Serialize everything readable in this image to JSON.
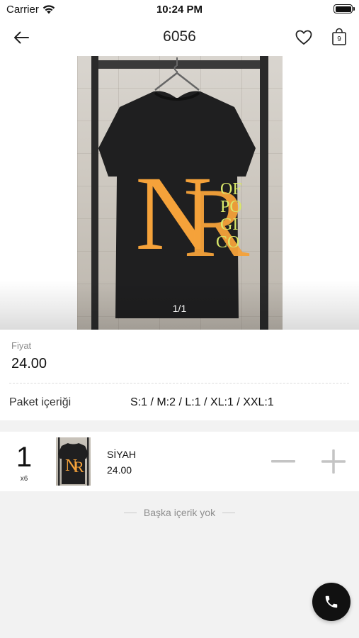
{
  "status_bar": {
    "carrier": "Carrier",
    "time": "10:24 PM"
  },
  "nav": {
    "title": "6056",
    "bag_count": "9"
  },
  "gallery": {
    "counter": "1/1",
    "shirt_print": [
      "OF",
      "PO",
      "GI",
      "CO"
    ]
  },
  "price": {
    "label": "Fiyat",
    "value": "24.00"
  },
  "package": {
    "label": "Paket içeriği",
    "value": "S:1 / M:2 / L:1 / XL:1 / XXL:1"
  },
  "variant": {
    "quantity": "1",
    "multiplier": "x6",
    "color": "SİYAH",
    "price": "24.00"
  },
  "empty_note": "Başka içerik yok",
  "colors": {
    "accent": "#111111",
    "print_orange": "#f5a23a",
    "print_yellow": "#d9e86a",
    "background": "#f2f2f2"
  },
  "icons": [
    "wifi-icon",
    "battery-icon",
    "back-arrow-icon",
    "heart-icon",
    "shopping-bag-icon",
    "minus-icon",
    "plus-icon",
    "phone-icon"
  ]
}
